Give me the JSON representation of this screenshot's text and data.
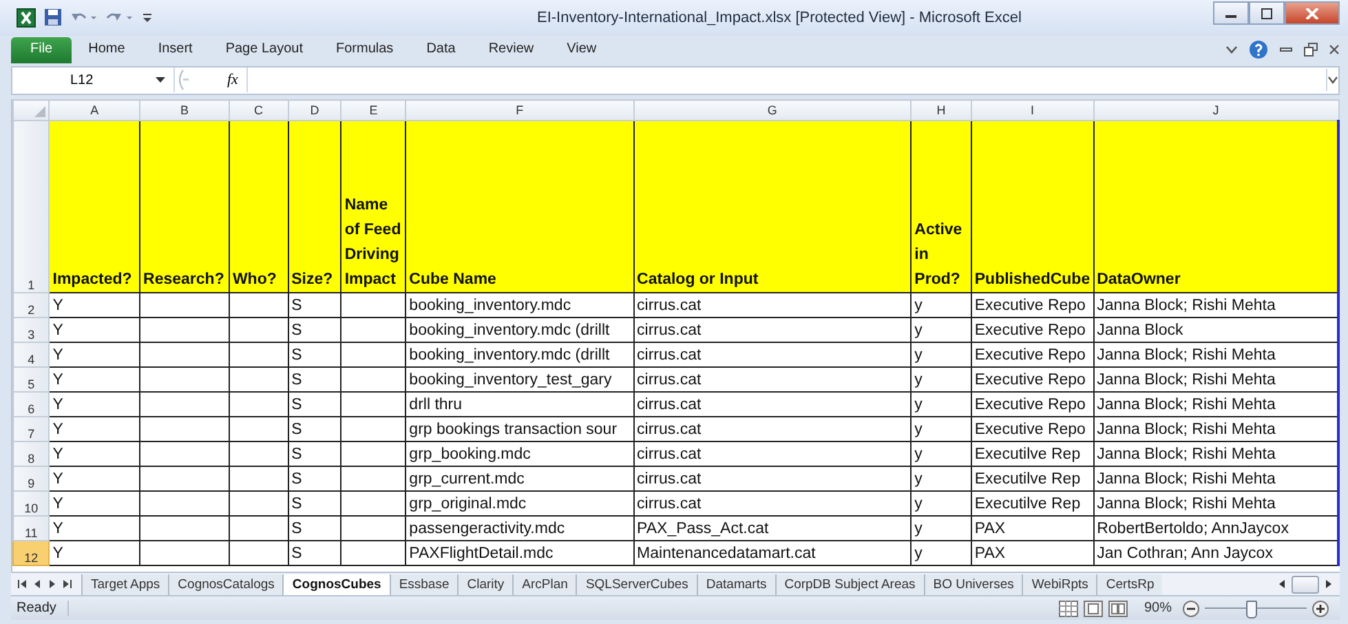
{
  "window": {
    "title": "EI-Inventory-International_Impact.xlsx  [Protected View] - Microsoft Excel"
  },
  "ribbon_tabs": [
    {
      "label": "File",
      "selected": true
    },
    {
      "label": "Home",
      "selected": false
    },
    {
      "label": "Insert",
      "selected": false
    },
    {
      "label": "Page Layout",
      "selected": false
    },
    {
      "label": "Formulas",
      "selected": false
    },
    {
      "label": "Data",
      "selected": false
    },
    {
      "label": "Review",
      "selected": false
    },
    {
      "label": "View",
      "selected": false
    }
  ],
  "formula_bar": {
    "name_box": "L12",
    "fx": "fx"
  },
  "sheet": {
    "columns": [
      "A",
      "B",
      "C",
      "D",
      "E",
      "F",
      "G",
      "H",
      "I",
      "J"
    ],
    "header_row": {
      "number": "1",
      "cells": [
        "Impacted?",
        "Research?",
        "Who?",
        "Size?",
        "Name of Feed Driving Impact",
        "Cube Name",
        "Catalog or Input",
        "Active in Prod?",
        "PublishedCube",
        "DataOwner"
      ]
    },
    "rows": [
      {
        "number": "2",
        "selected": false,
        "cells": [
          "Y",
          null,
          null,
          "S",
          null,
          "booking_inventory.mdc",
          "cirrus.cat",
          "y",
          "Executive Repo",
          "Janna Block; Rishi Mehta"
        ]
      },
      {
        "number": "3",
        "selected": false,
        "cells": [
          "Y",
          null,
          null,
          "S",
          null,
          "booking_inventory.mdc (drillt",
          "cirrus.cat",
          "y",
          "Executive Repo",
          "Janna Block"
        ]
      },
      {
        "number": "4",
        "selected": false,
        "cells": [
          "Y",
          null,
          null,
          "S",
          null,
          "booking_inventory.mdc (drillt",
          "cirrus.cat",
          "y",
          "Executive Repo",
          "Janna Block; Rishi Mehta"
        ]
      },
      {
        "number": "5",
        "selected": false,
        "cells": [
          "Y",
          null,
          null,
          "S",
          null,
          "booking_inventory_test_gary",
          "cirrus.cat",
          "y",
          "Executive Repo",
          "Janna Block; Rishi Mehta"
        ]
      },
      {
        "number": "6",
        "selected": false,
        "cells": [
          "Y",
          null,
          null,
          "S",
          null,
          "drll thru",
          "cirrus.cat",
          "y",
          "Executive Repo",
          "Janna Block; Rishi Mehta"
        ]
      },
      {
        "number": "7",
        "selected": false,
        "cells": [
          "Y",
          null,
          null,
          "S",
          null,
          "grp bookings transaction sour",
          "cirrus.cat",
          "y",
          "Executive Repo",
          "Janna Block; Rishi Mehta"
        ]
      },
      {
        "number": "8",
        "selected": false,
        "cells": [
          "Y",
          null,
          null,
          "S",
          null,
          "grp_booking.mdc",
          "cirrus.cat",
          "y",
          "Executilve Rep",
          "Janna Block; Rishi Mehta"
        ]
      },
      {
        "number": "9",
        "selected": false,
        "cells": [
          "Y",
          null,
          null,
          "S",
          null,
          "grp_current.mdc",
          "cirrus.cat",
          "y",
          "Executilve Rep",
          "Janna Block; Rishi Mehta"
        ]
      },
      {
        "number": "10",
        "selected": false,
        "cells": [
          "Y",
          null,
          null,
          "S",
          null,
          "grp_original.mdc",
          "cirrus.cat",
          "y",
          "Executilve Rep",
          "Janna Block; Rishi Mehta"
        ]
      },
      {
        "number": "11",
        "selected": false,
        "cells": [
          "Y",
          null,
          null,
          "S",
          null,
          "passengeractivity.mdc",
          "PAX_Pass_Act.cat",
          "y",
          "PAX",
          "RobertBertoldo; AnnJaycox"
        ]
      },
      {
        "number": "12",
        "selected": true,
        "cells": [
          "Y",
          null,
          null,
          "S",
          null,
          "PAXFlightDetail.mdc",
          "Maintenancedatamart.cat",
          "y",
          "PAX",
          "Jan Cothran; Ann Jaycox"
        ]
      }
    ]
  },
  "sheet_tabs": [
    {
      "label": "Target Apps",
      "selected": false
    },
    {
      "label": "CognosCatalogs",
      "selected": false
    },
    {
      "label": "CognosCubes",
      "selected": true
    },
    {
      "label": "Essbase",
      "selected": false
    },
    {
      "label": "Clarity",
      "selected": false
    },
    {
      "label": "ArcPlan",
      "selected": false
    },
    {
      "label": "SQLServerCubes",
      "selected": false
    },
    {
      "label": "Datamarts",
      "selected": false
    },
    {
      "label": "CorpDB Subject Areas",
      "selected": false
    },
    {
      "label": "BO Universes",
      "selected": false
    },
    {
      "label": "WebiRpts",
      "selected": false
    },
    {
      "label": "CertsRp",
      "selected": false
    }
  ],
  "status_bar": {
    "status": "Ready",
    "zoom": "90%",
    "zoom_slider": {
      "level": 0.45
    }
  }
}
